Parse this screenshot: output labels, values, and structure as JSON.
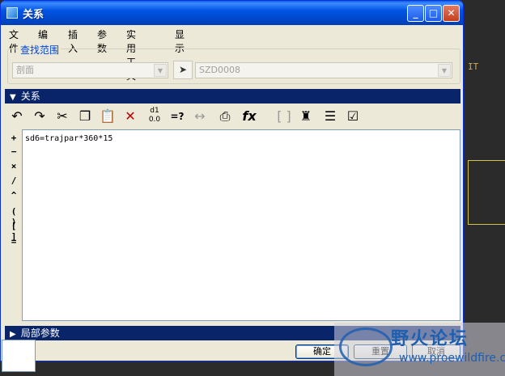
{
  "window": {
    "title": "关系"
  },
  "menu": [
    "文件",
    "编辑",
    "插入",
    "参数",
    "实用工具",
    "显示"
  ],
  "search_scope": {
    "label": "查找范围",
    "type_value": "剖面",
    "item_value": "SZD0008"
  },
  "relations_section": {
    "label": "关系"
  },
  "toolbar": {
    "icons": [
      "undo-icon",
      "redo-icon",
      "cut-icon",
      "copy-icon",
      "paste-icon",
      "delete-icon",
      "switch-dims-icon",
      "evaluate-icon",
      "measure-icon",
      "insert-from-list-icon",
      "function-icon",
      "parentheses-icon",
      "verify-icon",
      "sort-icon",
      "show-icon"
    ]
  },
  "operators": [
    "+",
    "−",
    "×",
    "/",
    "^",
    "( )",
    "[ ]",
    "="
  ],
  "editor": {
    "text": "sd6=trajpar*360*15"
  },
  "local_params_section": {
    "label": "局部参数"
  },
  "buttons": {
    "ok": "确定",
    "reset": "重置",
    "cancel": "取消"
  },
  "watermark": {
    "title": "野火论坛",
    "url": "www.proewildfire.cn"
  }
}
